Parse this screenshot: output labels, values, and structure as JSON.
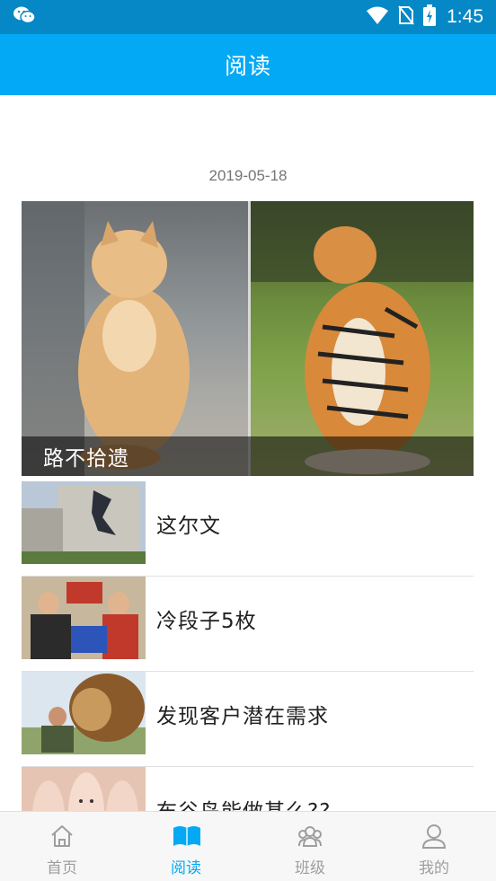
{
  "status_bar": {
    "time": "1:45",
    "icons": [
      "wechat-icon",
      "wifi-icon",
      "no-sim-icon",
      "battery-charging-icon"
    ]
  },
  "app_bar": {
    "title": "阅读"
  },
  "feed": {
    "date": "2019-05-18",
    "hero": {
      "caption": "路不拾遗"
    },
    "items": [
      {
        "title": "这尔文"
      },
      {
        "title": "冷段子5枚"
      },
      {
        "title": "发现客户潜在需求"
      },
      {
        "title": "布谷鸟能做甚么??"
      }
    ]
  },
  "tab_bar": {
    "active_index": 1,
    "active_color": "#03a9f4",
    "inactive_color": "#9e9e9e",
    "tabs": [
      {
        "label": "首页",
        "icon": "home-icon"
      },
      {
        "label": "阅读",
        "icon": "book-icon"
      },
      {
        "label": "班级",
        "icon": "group-icon"
      },
      {
        "label": "我的",
        "icon": "person-icon"
      }
    ]
  },
  "colors": {
    "status_bar": "#0588c5",
    "app_bar": "#03a9f4",
    "title_text": "#212121",
    "date_text": "#757575"
  }
}
